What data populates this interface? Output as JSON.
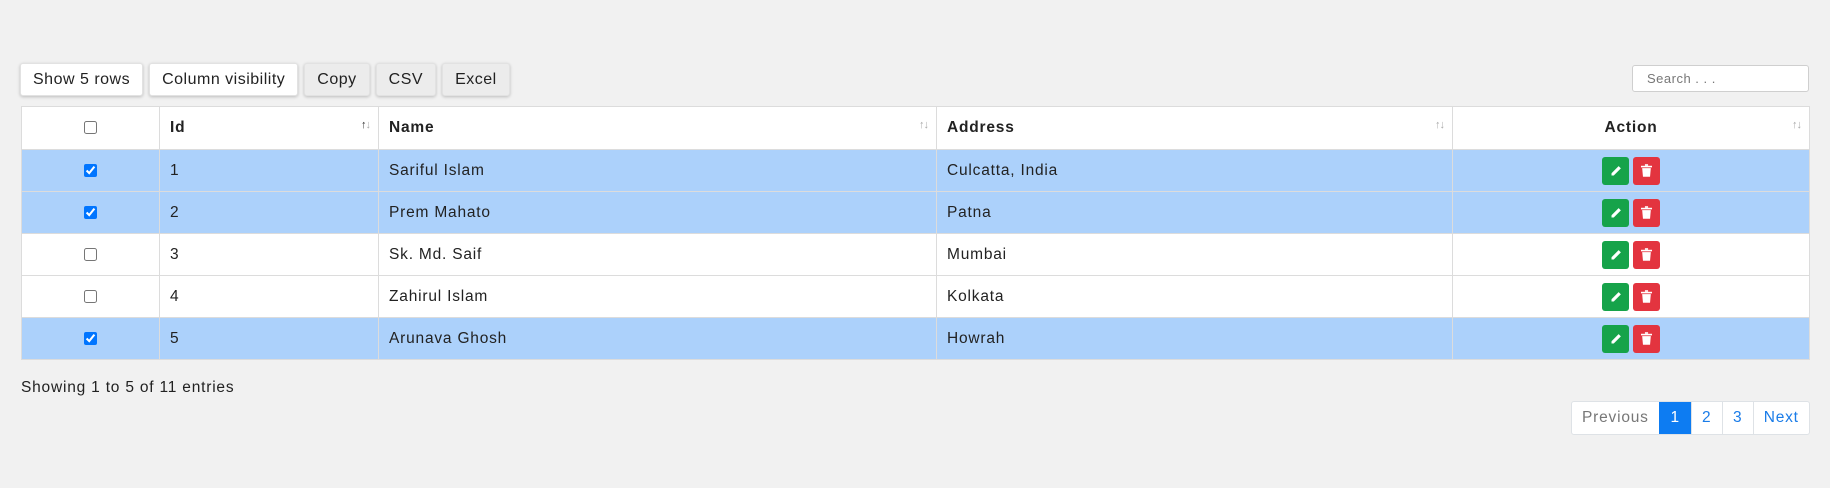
{
  "toolbar": {
    "show_rows": "Show 5 rows",
    "column_visibility": "Column visibility",
    "copy": "Copy",
    "csv": "CSV",
    "excel": "Excel"
  },
  "search": {
    "placeholder": "Search . . ."
  },
  "table": {
    "headers": {
      "id": "Id",
      "name": "Name",
      "address": "Address",
      "action": "Action"
    },
    "rows": [
      {
        "selected": true,
        "id": "1",
        "name": "Sariful Islam",
        "address": "Culcatta, India"
      },
      {
        "selected": true,
        "id": "2",
        "name": "Prem Mahato",
        "address": "Patna"
      },
      {
        "selected": false,
        "id": "3",
        "name": "Sk. Md. Saif",
        "address": "Mumbai"
      },
      {
        "selected": false,
        "id": "4",
        "name": "Zahirul Islam",
        "address": "Kolkata"
      },
      {
        "selected": true,
        "id": "5",
        "name": "Arunava Ghosh",
        "address": "Howrah"
      }
    ]
  },
  "info": "Showing 1 to 5 of 11 entries",
  "pagination": {
    "previous": "Previous",
    "pages": [
      "1",
      "2",
      "3"
    ],
    "next": "Next",
    "current": "1"
  },
  "colors": {
    "selected_row": "#acd1fb",
    "edit_button": "#16a34a",
    "delete_button": "#e3343f",
    "active_page": "#0d7cf2"
  },
  "icons": {
    "edit": "pencil-icon",
    "delete": "trash-icon"
  }
}
